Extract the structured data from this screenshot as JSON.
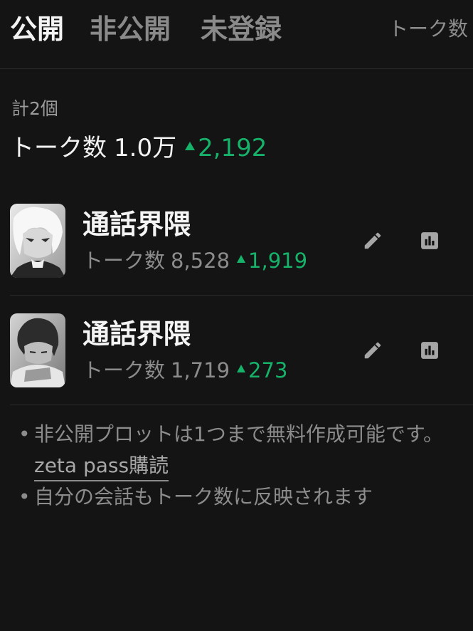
{
  "tabs": {
    "public": "公開",
    "private": "非公開",
    "unregistered": "未登録",
    "sort": "トーク数"
  },
  "summary": {
    "count": "計2個",
    "talk_label": "トーク数",
    "talk_value": "1.0万",
    "talk_delta": "2,192"
  },
  "items": [
    {
      "title": "通話界隈",
      "talk_label": "トーク数",
      "talk_value": "8,528",
      "talk_delta": "1,919"
    },
    {
      "title": "通話界隈",
      "talk_label": "トーク数",
      "talk_value": "1,719",
      "talk_delta": "273"
    }
  ],
  "notes": {
    "bullet": "•",
    "line1": "非公開プロットは1つまで無料作成可能です。",
    "link": "zeta pass購読",
    "line2": "自分の会話もトーク数に反映されます"
  },
  "icons": {
    "edit": "pencil-icon",
    "stats": "bar-chart-icon",
    "up": "triangle-up-icon"
  },
  "colors": {
    "background": "#141414",
    "accent_green": "#17b26a",
    "muted": "#8c8c8c"
  }
}
